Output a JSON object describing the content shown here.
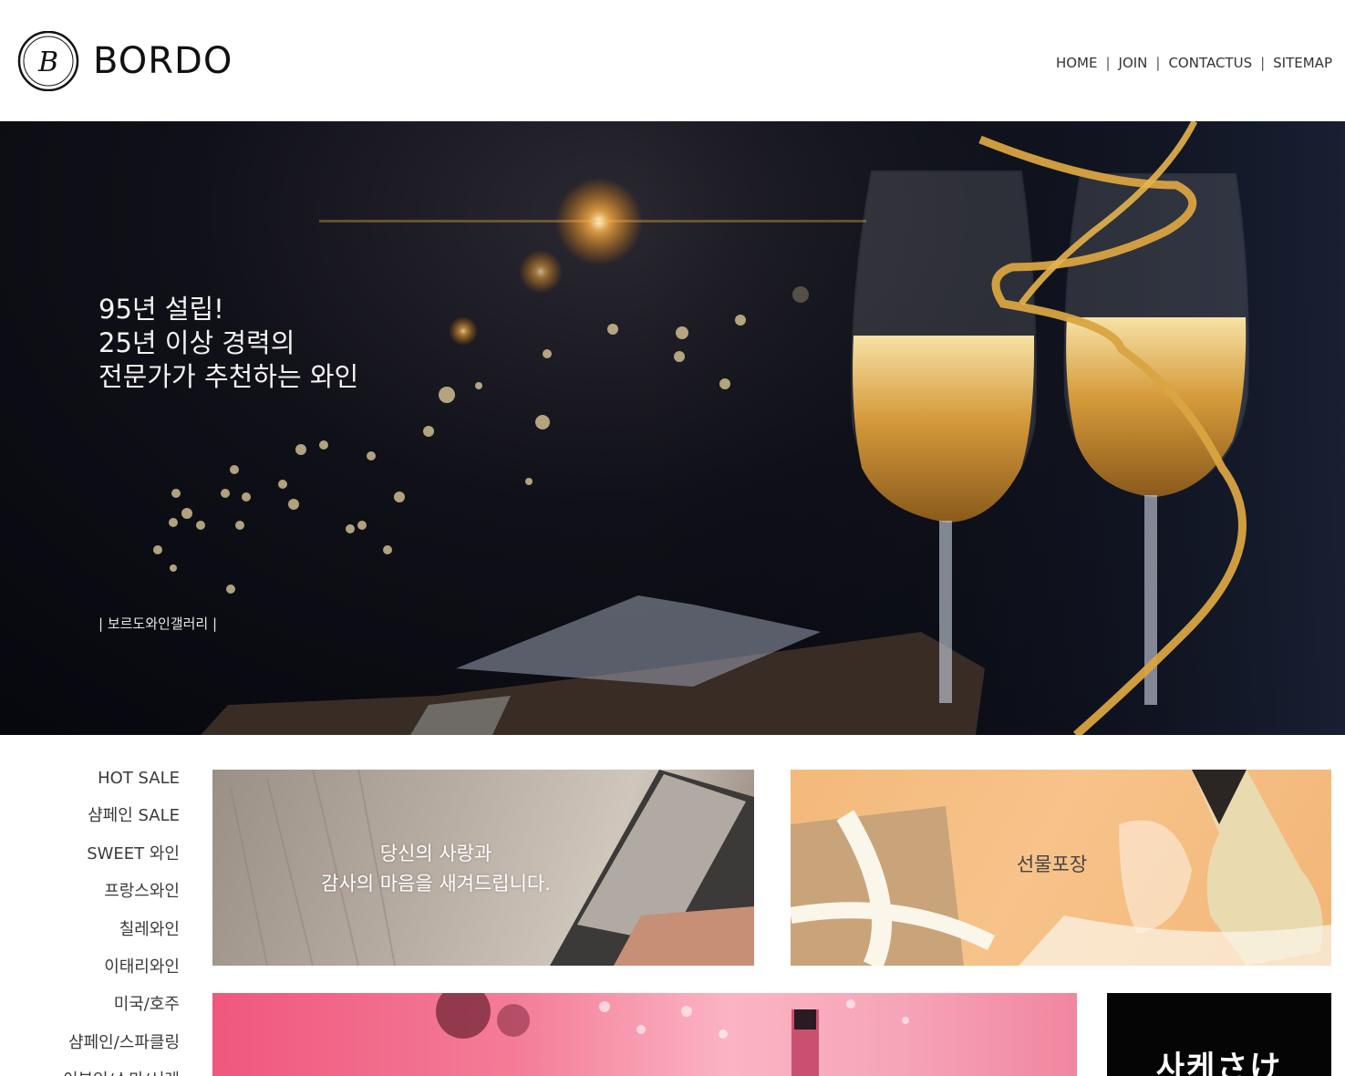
{
  "brand": {
    "name": "BORDO",
    "logo_letter": "B"
  },
  "topnav": {
    "items": [
      "HOME",
      "JOIN",
      "CONTACTUS",
      "SITEMAP"
    ],
    "separator": "|"
  },
  "hero": {
    "lines": [
      "95년 설립!",
      "25년 이상 경력의",
      "전문가가 추천하는 와인"
    ],
    "caption": "| 보르도와인갤러리 |"
  },
  "sidemenu": {
    "items": [
      "HOT SALE",
      "샴페인 SALE",
      "SWEET 와인",
      "프랑스와인",
      "칠레와인",
      "이태리와인",
      "미국/호주",
      "샴페인/스파클링",
      "이부인/스마/서레"
    ]
  },
  "banners": {
    "message": {
      "line1": "당신의 사랑과",
      "line2": "감사의 마음을 새겨드립니다."
    },
    "gift": {
      "label": "선물포장"
    },
    "black": {
      "label": "사케さけ"
    }
  },
  "colors": {
    "hero_bg": "#0a0b12",
    "gold": "#d9a441",
    "pink": "#f0577e",
    "gift_bg": "#f5bd80"
  }
}
